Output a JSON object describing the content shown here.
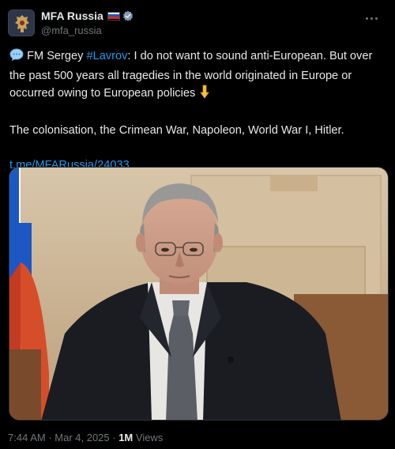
{
  "account": {
    "display_name": "MFA Russia",
    "handle": "@mfa_russia",
    "avatar_icon": "coat-of-arms-icon",
    "flag_icon": "russia-flag-icon",
    "verified_icon": "verified-badge-icon",
    "verified_color": "#829aab"
  },
  "post": {
    "line1_prefix": "FM Sergey ",
    "hashtag": "#Lavrov",
    "line1_rest": ": I do not want to sound anti-European. But over the past 500 years all tragedies in the world originated in Europe or occurred owing to European policies",
    "paragraph2": "The colonisation, the Crimean War, Napoleon, World War I, Hitler.",
    "link": "t.me/MFARussia/24033",
    "speech_icon": "speech-balloon-icon",
    "pointing_icon": "pointing-down-icon"
  },
  "media": {
    "description_icon": "photo"
  },
  "meta": {
    "time": "7:44 AM",
    "sep1": " · ",
    "date": "Mar 4, 2025",
    "sep2": " · ",
    "views_count": "1M",
    "views_label": " Views"
  },
  "colors": {
    "background": "#000000",
    "text": "#e7e9ea",
    "secondary": "#71767b",
    "link": "#1d9bf0"
  }
}
